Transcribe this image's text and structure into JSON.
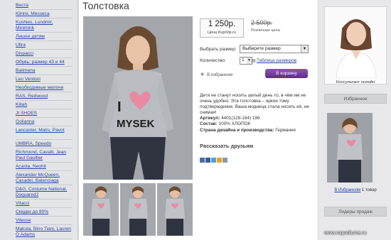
{
  "sidebar": {
    "items": [
      {
        "label": "Веста"
      },
      {
        "label": "Kilnini, Messeca"
      },
      {
        "label": "Kushies, Lundmir, Minimink"
      },
      {
        "label": "Лишее детям"
      },
      {
        "label": "Ultra"
      },
      {
        "label": "Dispacci"
      },
      {
        "label": "Обувь: размер 43 и 44"
      },
      {
        "label": "Balimena"
      },
      {
        "label": "Leo Ventoni"
      },
      {
        "label": "Необходимые мелочи"
      },
      {
        "label": "RAS, Redwood"
      },
      {
        "label": "Killah"
      },
      {
        "label": "JI SHOES"
      },
      {
        "label": "Golianna"
      },
      {
        "label": "Lancaster, Matis, Pavot"
      },
      {
        "label": "UMBRA, Speedo"
      },
      {
        "label": "Richmond, Cavalli, Jean Paul Gaultier"
      },
      {
        "label": "Acasta, Neohit"
      },
      {
        "label": "Alexander McQueen, Casadei, Balenciaga"
      },
      {
        "label": "D&G, Costume National, Dsquared2"
      },
      {
        "label": "Vitacci"
      },
      {
        "label": "Скидки до 80%"
      },
      {
        "label": "Vitesse"
      },
      {
        "label": "Makula, Bino Tiani, Lauren G Adams"
      }
    ]
  },
  "product": {
    "title": "Толстовка",
    "price_new": "1 250р.",
    "price_new_label": "Цена KupiVip.ru",
    "price_old": "2 500р.",
    "price_old_label": "Розничная цена",
    "size_label": "Выбрать размер:",
    "size_value": "Выберите размер",
    "qty_label": "Количество:",
    "qty_value": "1",
    "size_table": "Таблица размеров",
    "favorite": "В избранном",
    "cart_button": "В корзину",
    "description": "Дети не станут носить целый день то, в чём им не очень удобно. Эта толстовка – яркое тому подтверждение. Ваша модница стала носить её, не снимая!",
    "article_label": "Артикул:",
    "article_value": "4401(128-164) 196",
    "composition_label": "Состав:",
    "composition_value": "100% ХЛОПОК",
    "country_label": "Страна дизайна и производства:",
    "country_value": "Германия",
    "share_title": "Рассказать друзьям",
    "shirt_text": "MYSEK",
    "shirt_letter": "I"
  },
  "share_icons": [
    {
      "name": "vk-icon",
      "color": "#4a6ea3"
    },
    {
      "name": "facebook-icon",
      "color": "#3b5998"
    },
    {
      "name": "twitter-icon",
      "color": "#4aa5d6"
    },
    {
      "name": "mailru-icon",
      "color": "#f0a020"
    },
    {
      "name": "odnoklassniki-icon",
      "color": "#8a9aa8"
    }
  ],
  "right": {
    "consult_label": "Консультант онлайн",
    "favorites_header": "Избранное",
    "favorites_prefix": "В Избранном",
    "favorites_count": "1",
    "favorites_suffix": "товар",
    "leaders_header": "Лидеры продаж"
  },
  "watermark": "www.napodiume.ru"
}
